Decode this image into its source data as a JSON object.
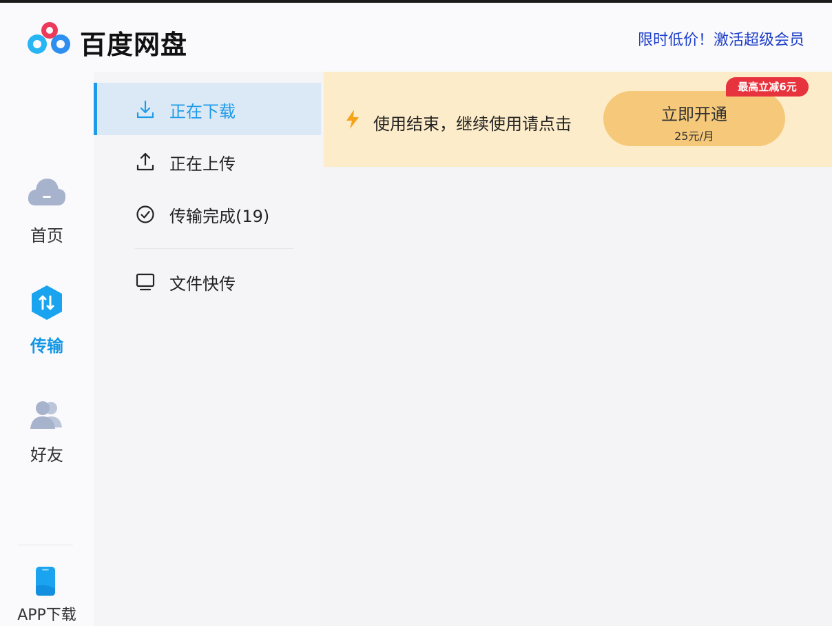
{
  "header": {
    "title": "百度网盘",
    "promo": "限时低价！激活超级会员"
  },
  "nav": {
    "items": [
      {
        "label": "首页",
        "icon": "cloud-home-icon"
      },
      {
        "label": "传输",
        "icon": "transfer-icon",
        "active": true
      },
      {
        "label": "好友",
        "icon": "friends-icon"
      }
    ],
    "app_download": "APP下载"
  },
  "transfer_menu": {
    "items": [
      {
        "label": "正在下载",
        "icon": "download-icon",
        "active": true
      },
      {
        "label": "正在上传",
        "icon": "upload-icon"
      },
      {
        "label": "传输完成(19)",
        "icon": "check-circle-icon"
      },
      {
        "label": "文件快传",
        "icon": "monitor-icon"
      }
    ]
  },
  "banner": {
    "message": "使用结束，继续使用请点击",
    "cta_label": "立即开通",
    "cta_price": "25元/月",
    "badge": "最高立减6元"
  },
  "colors": {
    "accent": "#1e9be8",
    "promo_text": "#1e3fc8",
    "banner_bg": "#fdecc9",
    "cta_bg": "#f6c97a",
    "badge_bg": "#e7333d"
  }
}
